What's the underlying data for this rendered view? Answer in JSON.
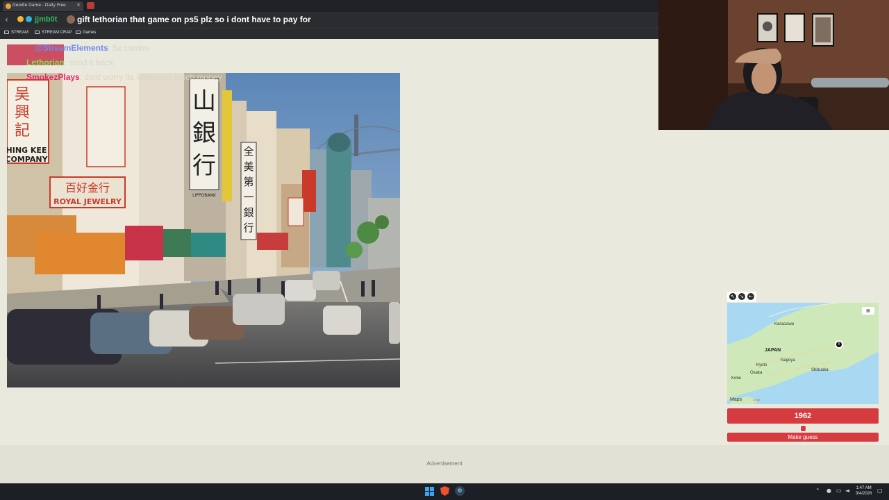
{
  "browser": {
    "tab_title": "Geodle Game - Daily Free",
    "tab_close": "×"
  },
  "navbar": {
    "back_icon": "back-arrow-icon",
    "chat_user": "jjmb0t",
    "chat_message": "gift lethorian that game on ps5 plz so i dont have to pay for"
  },
  "bookmarks": [
    {
      "label": "STREAM",
      "icon": "folder-icon"
    },
    {
      "label": "STREAM CRAP",
      "icon": "folder-icon"
    },
    {
      "label": "Games",
      "icon": "folder-icon"
    }
  ],
  "chat": [
    {
      "user": "@StreamElements",
      "sep": ": ",
      "text": "5x combo"
    },
    {
      "user": "Lethorian",
      "sep": ": ",
      "text": "send it back"
    },
    {
      "user": "SmokezPlays",
      "sep": ": ",
      "text": "dont worry its lethorians lunch money"
    }
  ],
  "photo": {
    "signs": [
      "山",
      "銀",
      "行",
      "吴",
      "興",
      "記",
      "HING KEE",
      "COMPANY",
      "ROYAL JEWELRY",
      "百好金行",
      "全",
      "美",
      "第",
      "一",
      "銀",
      "行",
      "LIPPOBANK"
    ]
  },
  "map": {
    "labels": {
      "kanazawa": "Kanazawa",
      "japan": "JAPAN",
      "nagoya": "Nagoya",
      "kyoto": "Kyoto",
      "osaka": "Osaka",
      "kobe": "Kobe",
      "shizuoka": "Shizuoka"
    },
    "logo": "Maps",
    "legal": "Legal",
    "controls": [
      "expand-icon",
      "shrink-icon",
      "back-icon"
    ]
  },
  "game": {
    "year": "1962",
    "slider_position": 0.5,
    "guess_label": "Make guess"
  },
  "ad": {
    "label": "Advertisement"
  },
  "taskbar": {
    "time": "1:47 AM",
    "date": "3/4/2026"
  },
  "colors": {
    "accent": "#d63b40",
    "page_bg": "#eae9dd",
    "map_water": "#a9d8f2",
    "map_land": "#cfe8b9"
  }
}
